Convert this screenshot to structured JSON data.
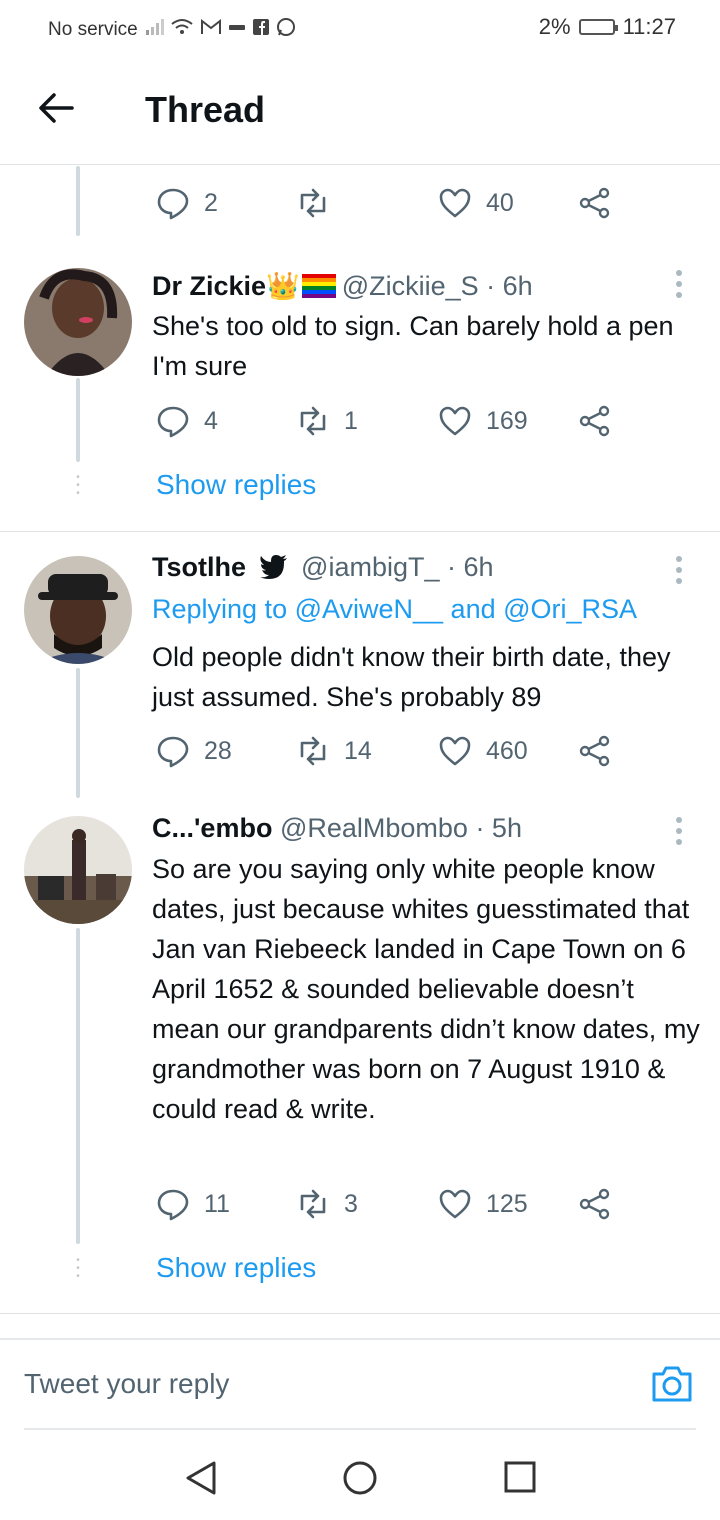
{
  "status": {
    "carrier": "No service",
    "battery": "2%",
    "time": "11:27"
  },
  "header": {
    "title": "Thread"
  },
  "top_actions": {
    "replies": "2",
    "retweets": "",
    "likes": "40"
  },
  "tweets": [
    {
      "name": "Dr Zickie",
      "handle": "@Zickiie_S · 6h",
      "text": "She's too old to sign. Can barely hold a pen I'm sure",
      "replies": "4",
      "retweets": "1",
      "likes": "169",
      "show_replies": "Show replies"
    },
    {
      "name": "Tsotlhe",
      "handle": "@iambigT_ · 6h",
      "replying_to": "Replying to @AviweN__ and @Ori_RSA",
      "text": "Old people didn't know their birth date, they just assumed. She's probably 89",
      "replies": "28",
      "retweets": "14",
      "likes": "460"
    },
    {
      "name": "C...'embo",
      "handle": "@RealMbombo · 5h",
      "text": "So are you saying only white people know dates, just because whites guesstimated that Jan van Riebeeck landed in Cape Town on 6 April 1652 & sounded believable doesn’t mean our grandparents didn’t know dates, my grandmother was born on 7 August 1910 & could read & write.",
      "replies": "11",
      "retweets": "3",
      "likes": "125",
      "show_replies": "Show replies"
    }
  ],
  "reply_box": {
    "placeholder": "Tweet your reply"
  },
  "colors": {
    "accent": "#1d9bf0",
    "secondary_text": "#536471",
    "divider": "#dfe3e6"
  }
}
